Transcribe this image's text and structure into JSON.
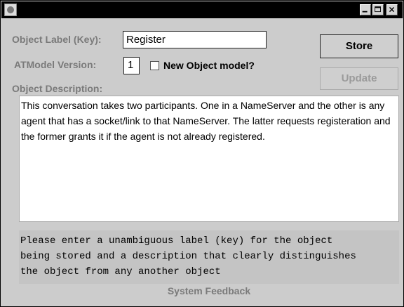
{
  "window": {
    "icon": "app-icon",
    "controls": [
      "minimize-icon",
      "maximize-icon",
      "close-icon"
    ]
  },
  "form": {
    "object_label_caption": "Object Label (Key):",
    "object_label_value": "Register",
    "atmodel_version_caption": "ATModel Version:",
    "atmodel_version_value": "1",
    "new_object_model_label": "New Object model?",
    "new_object_model_checked": false,
    "object_description_caption": "Object Description:",
    "object_description_text": "This conversation takes two participants.  One in a NameServer and the other is any agent that has a socket/link to that NameServer.  The latter requests registeration and the former grants it if the agent is not already registered."
  },
  "buttons": {
    "store": "Store",
    "update": "Update"
  },
  "feedback": {
    "text": "Please enter a unambiguous label (key) for the object\nbeing stored and a description that clearly distinguishes\nthe object from any another object",
    "label": "System Feedback"
  }
}
